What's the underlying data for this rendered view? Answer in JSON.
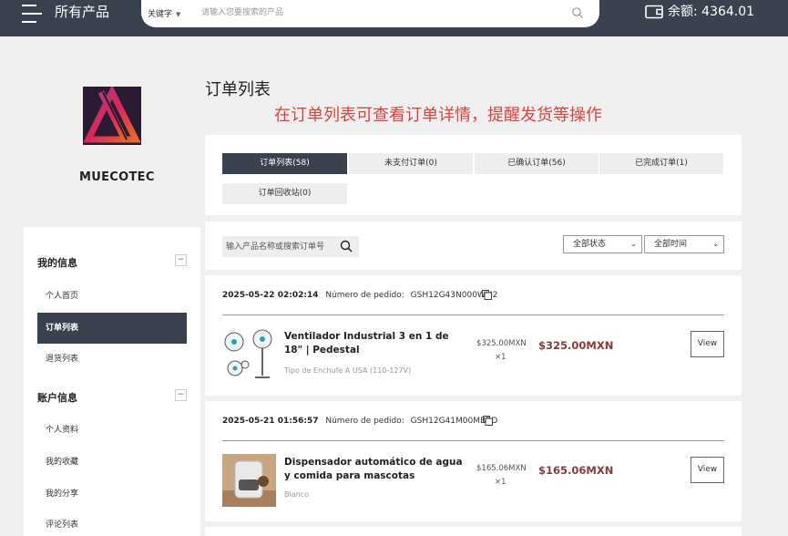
{
  "header": {
    "menu_label": "所有产品",
    "search_type": "关键字",
    "search_placeholder": "请输入您要搜索的产品",
    "balance": "余额: 4364.01"
  },
  "brand": {
    "name": "MUECOTEC"
  },
  "sidebar": {
    "sections": [
      {
        "title": "我的信息",
        "collapse": "−",
        "items": [
          "个人首页",
          "订单列表",
          "退货列表"
        ]
      },
      {
        "title": "账户信息",
        "collapse": "−",
        "items": [
          "个人资料",
          "我的收藏",
          "我的分享",
          "评论列表"
        ]
      }
    ],
    "active_item": "订单列表"
  },
  "main": {
    "title": "订单列表",
    "promo": "在订单列表可查看订单详情，提醒发货等操作",
    "tabs": [
      {
        "label": "订单列表(58)",
        "active": true
      },
      {
        "label": "未支付订单(0)",
        "active": false
      },
      {
        "label": "已确认订单(56)",
        "active": false
      },
      {
        "label": "已完成订单(1)",
        "active": false
      },
      {
        "label": "订单回收站(0)",
        "active": false
      }
    ],
    "filter": {
      "search_placeholder": "输入产品名称或搜索订单号",
      "status_select": "全部状态",
      "time_select": "全部时间"
    },
    "orders": [
      {
        "datetime": "2025-05-22 02:02:14",
        "order_label": "Número de pedido:",
        "order_number": "GSH12G43N000WM2",
        "product_name": "Ventilador Industrial 3 en 1 de 18\" | Pedestal",
        "variant": "Tipo de Enchufe A USA (110-127V)",
        "unit_price": "$325.00MXN",
        "qty": "×1",
        "total": "$325.00MXN",
        "action": "View"
      },
      {
        "datetime": "2025-05-21 01:56:57",
        "order_label": "Número de pedido:",
        "order_number": "GSH12G41M00MBBD",
        "product_name": "Dispensador automático de agua y comida para mascotas",
        "variant": "Blanco",
        "unit_price": "$165.06MXN",
        "qty": "×1",
        "total": "$165.06MXN",
        "action": "View"
      }
    ]
  },
  "colors": {
    "topbar": "#3a4250",
    "accent_red": "#e0413b",
    "price": "#8b3a3a"
  }
}
